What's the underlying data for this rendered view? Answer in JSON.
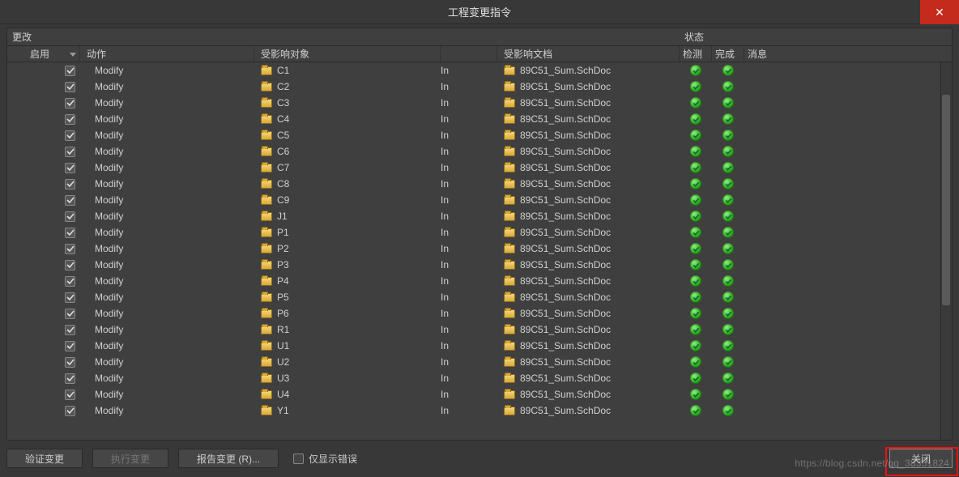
{
  "window": {
    "title": "工程变更指令",
    "close_x": "✕"
  },
  "sections": {
    "changes": "更改",
    "status": "状态"
  },
  "columns": {
    "enable": "启用",
    "action": "动作",
    "object": "受影响对象",
    "in": "",
    "doc": "受影响文档",
    "detect": "检测",
    "done": "完成",
    "message": "消息"
  },
  "row_defaults": {
    "action": "Modify",
    "in": "In",
    "doc": "89C51_Sum.SchDoc",
    "enabled": true,
    "detected": true,
    "done": true
  },
  "rows": [
    {
      "object": "C1"
    },
    {
      "object": "C2"
    },
    {
      "object": "C3"
    },
    {
      "object": "C4"
    },
    {
      "object": "C5"
    },
    {
      "object": "C6"
    },
    {
      "object": "C7"
    },
    {
      "object": "C8"
    },
    {
      "object": "C9"
    },
    {
      "object": "J1"
    },
    {
      "object": "P1"
    },
    {
      "object": "P2"
    },
    {
      "object": "P3"
    },
    {
      "object": "P4"
    },
    {
      "object": "P5"
    },
    {
      "object": "P6"
    },
    {
      "object": "R1"
    },
    {
      "object": "U1"
    },
    {
      "object": "U2"
    },
    {
      "object": "U3"
    },
    {
      "object": "U4"
    },
    {
      "object": "Y1"
    }
  ],
  "footer": {
    "validate": "验证变更",
    "execute": "执行变更",
    "report": "报告变更 (R)...",
    "only_errors": "仅显示错误",
    "close": "关闭"
  },
  "watermark": "https://blog.csdn.net/qq_38351824"
}
